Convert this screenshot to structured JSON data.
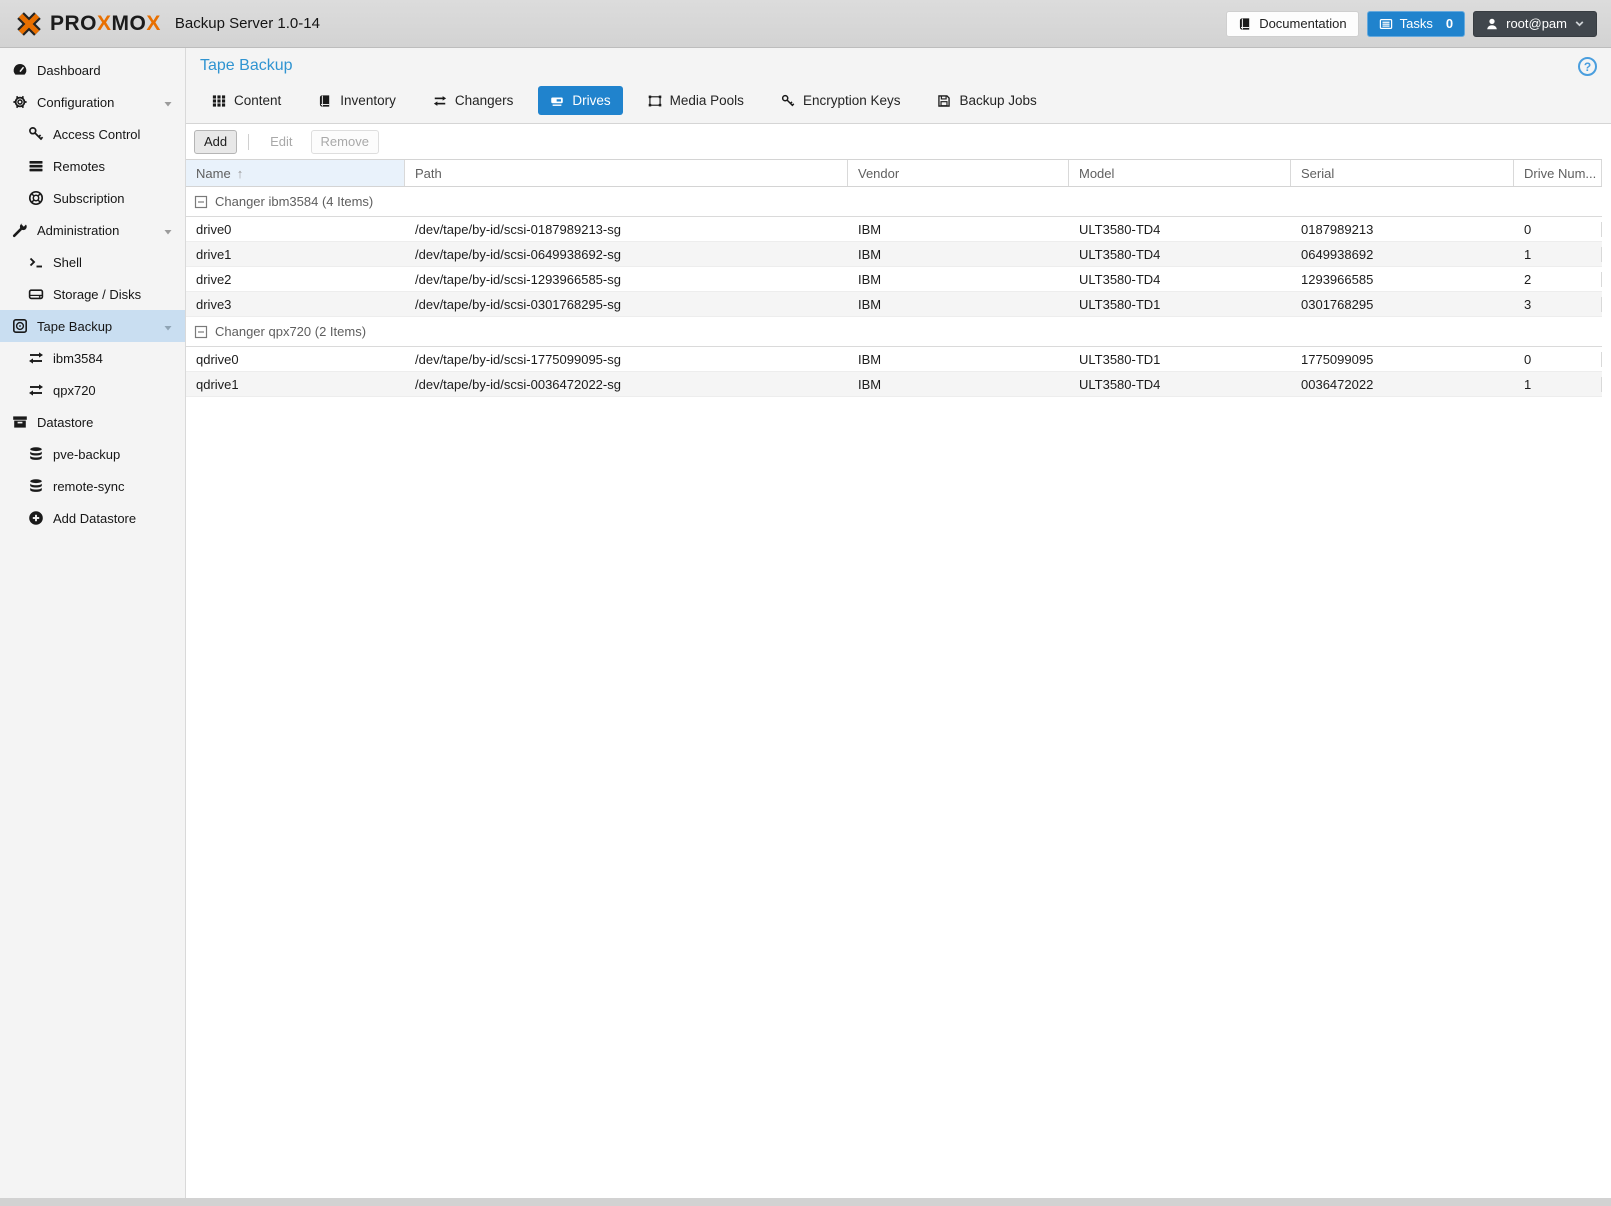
{
  "topbar": {
    "logo": {
      "p1": "PRO",
      "x1": "X",
      "p2": "MO",
      "x2": "X"
    },
    "subtitle": "Backup Server 1.0-14",
    "documentation_label": "Documentation",
    "tasks_label": "Tasks",
    "tasks_count": "0",
    "user_label": "root@pam",
    "accent_color": "#2083cd",
    "user_button_color": "#41474d"
  },
  "sidebar": {
    "items": [
      {
        "label": "Dashboard",
        "icon": "gauge-icon",
        "level": 0
      },
      {
        "label": "Configuration",
        "icon": "gears-icon",
        "level": 0,
        "expandable": true
      },
      {
        "label": "Access Control",
        "icon": "key-icon",
        "level": 1
      },
      {
        "label": "Remotes",
        "icon": "remotes-icon",
        "level": 1
      },
      {
        "label": "Subscription",
        "icon": "life-ring-icon",
        "level": 1
      },
      {
        "label": "Administration",
        "icon": "wrench-icon",
        "level": 0,
        "expandable": true
      },
      {
        "label": "Shell",
        "icon": "terminal-icon",
        "level": 1
      },
      {
        "label": "Storage / Disks",
        "icon": "hdd-icon",
        "level": 1
      },
      {
        "label": "Tape Backup",
        "icon": "tape-icon",
        "level": 0,
        "expandable": true,
        "selected": true
      },
      {
        "label": "ibm3584",
        "icon": "exchange-icon",
        "level": 1
      },
      {
        "label": "qpx720",
        "icon": "exchange-icon",
        "level": 1
      },
      {
        "label": "Datastore",
        "icon": "archive-icon",
        "level": 0
      },
      {
        "label": "pve-backup",
        "icon": "database-icon",
        "level": 1
      },
      {
        "label": "remote-sync",
        "icon": "database-icon",
        "level": 1
      },
      {
        "label": "Add Datastore",
        "icon": "plus-circle-icon",
        "level": 1
      }
    ],
    "selected_bg": "#c9def1"
  },
  "content": {
    "title": "Tape Backup",
    "help_glyph": "?",
    "tabs": [
      {
        "label": "Content",
        "icon": "grid-icon",
        "selected": false
      },
      {
        "label": "Inventory",
        "icon": "book-icon",
        "selected": false
      },
      {
        "label": "Changers",
        "icon": "exchange-icon",
        "selected": false
      },
      {
        "label": "Drives",
        "icon": "tape-drive-icon",
        "selected": true
      },
      {
        "label": "Media Pools",
        "icon": "object-group-icon",
        "selected": false
      },
      {
        "label": "Encryption Keys",
        "icon": "key-icon",
        "selected": false
      },
      {
        "label": "Backup Jobs",
        "icon": "floppy-icon",
        "selected": false
      }
    ],
    "toolbar": {
      "add_label": "Add",
      "edit_label": "Edit",
      "remove_label": "Remove"
    },
    "grid": {
      "sort_indicator": "↑",
      "columns": [
        {
          "label": "Name",
          "sorted": "asc"
        },
        {
          "label": "Path"
        },
        {
          "label": "Vendor"
        },
        {
          "label": "Model"
        },
        {
          "label": "Serial"
        },
        {
          "label": "Drive Num..."
        }
      ],
      "groups": [
        {
          "label": "Changer ibm3584 (4 Items)",
          "rows": [
            {
              "name": "drive0",
              "path": "/dev/tape/by-id/scsi-0187989213-sg",
              "vendor": "IBM",
              "model": "ULT3580-TD4",
              "serial": "0187989213",
              "drive_number": "0"
            },
            {
              "name": "drive1",
              "path": "/dev/tape/by-id/scsi-0649938692-sg",
              "vendor": "IBM",
              "model": "ULT3580-TD4",
              "serial": "0649938692",
              "drive_number": "1"
            },
            {
              "name": "drive2",
              "path": "/dev/tape/by-id/scsi-1293966585-sg",
              "vendor": "IBM",
              "model": "ULT3580-TD4",
              "serial": "1293966585",
              "drive_number": "2"
            },
            {
              "name": "drive3",
              "path": "/dev/tape/by-id/scsi-0301768295-sg",
              "vendor": "IBM",
              "model": "ULT3580-TD1",
              "serial": "0301768295",
              "drive_number": "3"
            }
          ]
        },
        {
          "label": "Changer qpx720 (2 Items)",
          "rows": [
            {
              "name": "qdrive0",
              "path": "/dev/tape/by-id/scsi-1775099095-sg",
              "vendor": "IBM",
              "model": "ULT3580-TD1",
              "serial": "1775099095",
              "drive_number": "0"
            },
            {
              "name": "qdrive1",
              "path": "/dev/tape/by-id/scsi-0036472022-sg",
              "vendor": "IBM",
              "model": "ULT3580-TD4",
              "serial": "0036472022",
              "drive_number": "1"
            }
          ]
        }
      ]
    }
  }
}
